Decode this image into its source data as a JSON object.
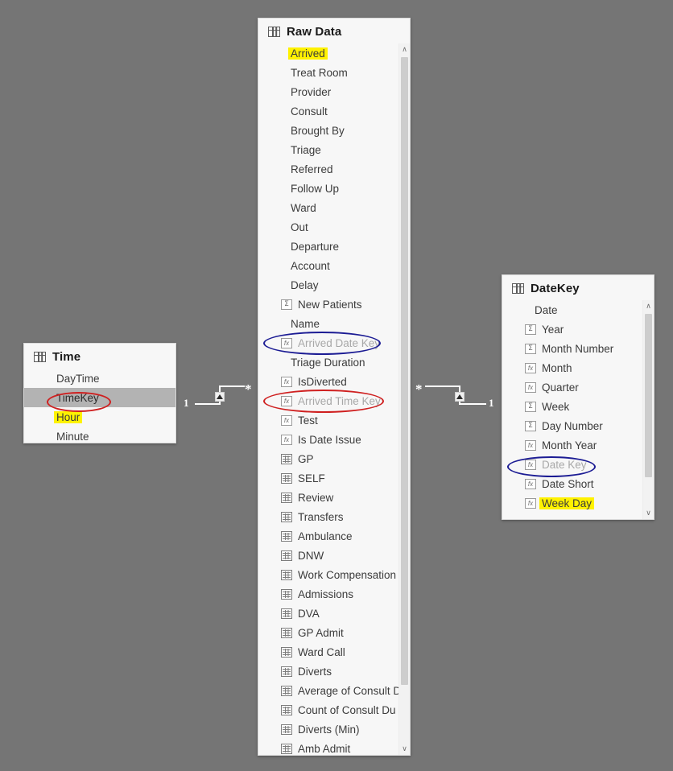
{
  "canvas": {
    "background": "#757575"
  },
  "annotation_colors": {
    "highlight": "#fff200",
    "red": "#cf2020",
    "blue": "#1c1c94"
  },
  "tables": {
    "time": {
      "name": "Time",
      "icon": "table-icon",
      "fields": [
        {
          "label": "DayTime",
          "icon": "none",
          "state": "normal"
        },
        {
          "label": "TimeKey",
          "icon": "none",
          "state": "selected",
          "annotation": "red-circle"
        },
        {
          "label": "Hour",
          "icon": "none",
          "state": "normal",
          "annotation": "yellow-highlight"
        },
        {
          "label": "Minute",
          "icon": "none",
          "state": "normal"
        }
      ]
    },
    "raw_data": {
      "name": "Raw Data",
      "icon": "table-icon",
      "fields": [
        {
          "label": "Arrived",
          "icon": "none",
          "state": "normal",
          "annotation": "yellow-highlight"
        },
        {
          "label": "Treat Room",
          "icon": "none",
          "state": "normal"
        },
        {
          "label": "Provider",
          "icon": "none",
          "state": "normal"
        },
        {
          "label": "Consult",
          "icon": "none",
          "state": "normal"
        },
        {
          "label": "Brought By",
          "icon": "none",
          "state": "normal"
        },
        {
          "label": "Triage",
          "icon": "none",
          "state": "normal"
        },
        {
          "label": "Referred",
          "icon": "none",
          "state": "normal"
        },
        {
          "label": "Follow Up",
          "icon": "none",
          "state": "normal"
        },
        {
          "label": "Ward",
          "icon": "none",
          "state": "normal"
        },
        {
          "label": "Out",
          "icon": "none",
          "state": "normal"
        },
        {
          "label": "Departure",
          "icon": "none",
          "state": "normal"
        },
        {
          "label": "Account",
          "icon": "none",
          "state": "normal"
        },
        {
          "label": "Delay",
          "icon": "none",
          "state": "normal"
        },
        {
          "label": "New Patients",
          "icon": "sigma-icon",
          "state": "normal"
        },
        {
          "label": "Name",
          "icon": "none",
          "state": "normal"
        },
        {
          "label": "Arrived Date Key",
          "icon": "fx-icon",
          "state": "dim",
          "annotation": "blue-circle"
        },
        {
          "label": "Triage Duration",
          "icon": "none",
          "state": "normal"
        },
        {
          "label": "IsDiverted",
          "icon": "fx-icon",
          "state": "normal"
        },
        {
          "label": "Arrived Time Key",
          "icon": "fx-icon",
          "state": "dim",
          "annotation": "red-circle"
        },
        {
          "label": "Test",
          "icon": "fx-icon",
          "state": "normal"
        },
        {
          "label": "Is Date Issue",
          "icon": "fx-icon",
          "state": "normal"
        },
        {
          "label": "GP",
          "icon": "measure-icon",
          "state": "normal"
        },
        {
          "label": "SELF",
          "icon": "measure-icon",
          "state": "normal"
        },
        {
          "label": "Review",
          "icon": "measure-icon",
          "state": "normal"
        },
        {
          "label": "Transfers",
          "icon": "measure-icon",
          "state": "normal"
        },
        {
          "label": "Ambulance",
          "icon": "measure-icon",
          "state": "normal"
        },
        {
          "label": "DNW",
          "icon": "measure-icon",
          "state": "normal"
        },
        {
          "label": "Work Compensation",
          "icon": "measure-icon",
          "state": "normal"
        },
        {
          "label": "Admissions",
          "icon": "measure-icon",
          "state": "normal"
        },
        {
          "label": "DVA",
          "icon": "measure-icon",
          "state": "normal"
        },
        {
          "label": "GP Admit",
          "icon": "measure-icon",
          "state": "normal"
        },
        {
          "label": "Ward Call",
          "icon": "measure-icon",
          "state": "normal"
        },
        {
          "label": "Diverts",
          "icon": "measure-icon",
          "state": "normal"
        },
        {
          "label": "Average of Consult D",
          "icon": "measure-icon",
          "state": "normal"
        },
        {
          "label": "Count of Consult Du",
          "icon": "measure-icon",
          "state": "normal"
        },
        {
          "label": "Diverts (Min)",
          "icon": "measure-icon",
          "state": "normal"
        },
        {
          "label": "Amb Admit",
          "icon": "measure-icon",
          "state": "normal"
        }
      ]
    },
    "datekey": {
      "name": "DateKey",
      "icon": "table-icon",
      "fields": [
        {
          "label": "Date",
          "icon": "none",
          "state": "normal"
        },
        {
          "label": "Year",
          "icon": "sigma-icon",
          "state": "normal"
        },
        {
          "label": "Month Number",
          "icon": "sigma-icon",
          "state": "normal"
        },
        {
          "label": "Month",
          "icon": "fx-icon",
          "state": "normal"
        },
        {
          "label": "Quarter",
          "icon": "fx-icon",
          "state": "normal"
        },
        {
          "label": "Week",
          "icon": "sigma-icon",
          "state": "normal"
        },
        {
          "label": "Day Number",
          "icon": "sigma-icon",
          "state": "normal"
        },
        {
          "label": "Month Year",
          "icon": "fx-icon",
          "state": "normal"
        },
        {
          "label": "Date Key",
          "icon": "fx-icon",
          "state": "dim",
          "annotation": "blue-circle"
        },
        {
          "label": "Date Short",
          "icon": "fx-icon",
          "state": "normal"
        },
        {
          "label": "Week Day",
          "icon": "fx-icon",
          "state": "normal",
          "annotation": "yellow-highlight"
        }
      ]
    }
  },
  "relationships": [
    {
      "id": "time-to-rawdata",
      "from_table": "Time",
      "to_table": "Raw Data",
      "from_cardinality": "1",
      "to_cardinality": "*",
      "cross_filter": "single-direction-arrow"
    },
    {
      "id": "rawdata-to-datekey",
      "from_table": "Raw Data",
      "to_table": "DateKey",
      "from_cardinality": "*",
      "to_cardinality": "1",
      "cross_filter": "single-direction-arrow"
    }
  ],
  "scrollbars": {
    "raw_data": {
      "up_arrow": "∧",
      "down_arrow": "∨"
    },
    "datekey": {
      "up_arrow": "∧",
      "down_arrow": "∨"
    }
  }
}
